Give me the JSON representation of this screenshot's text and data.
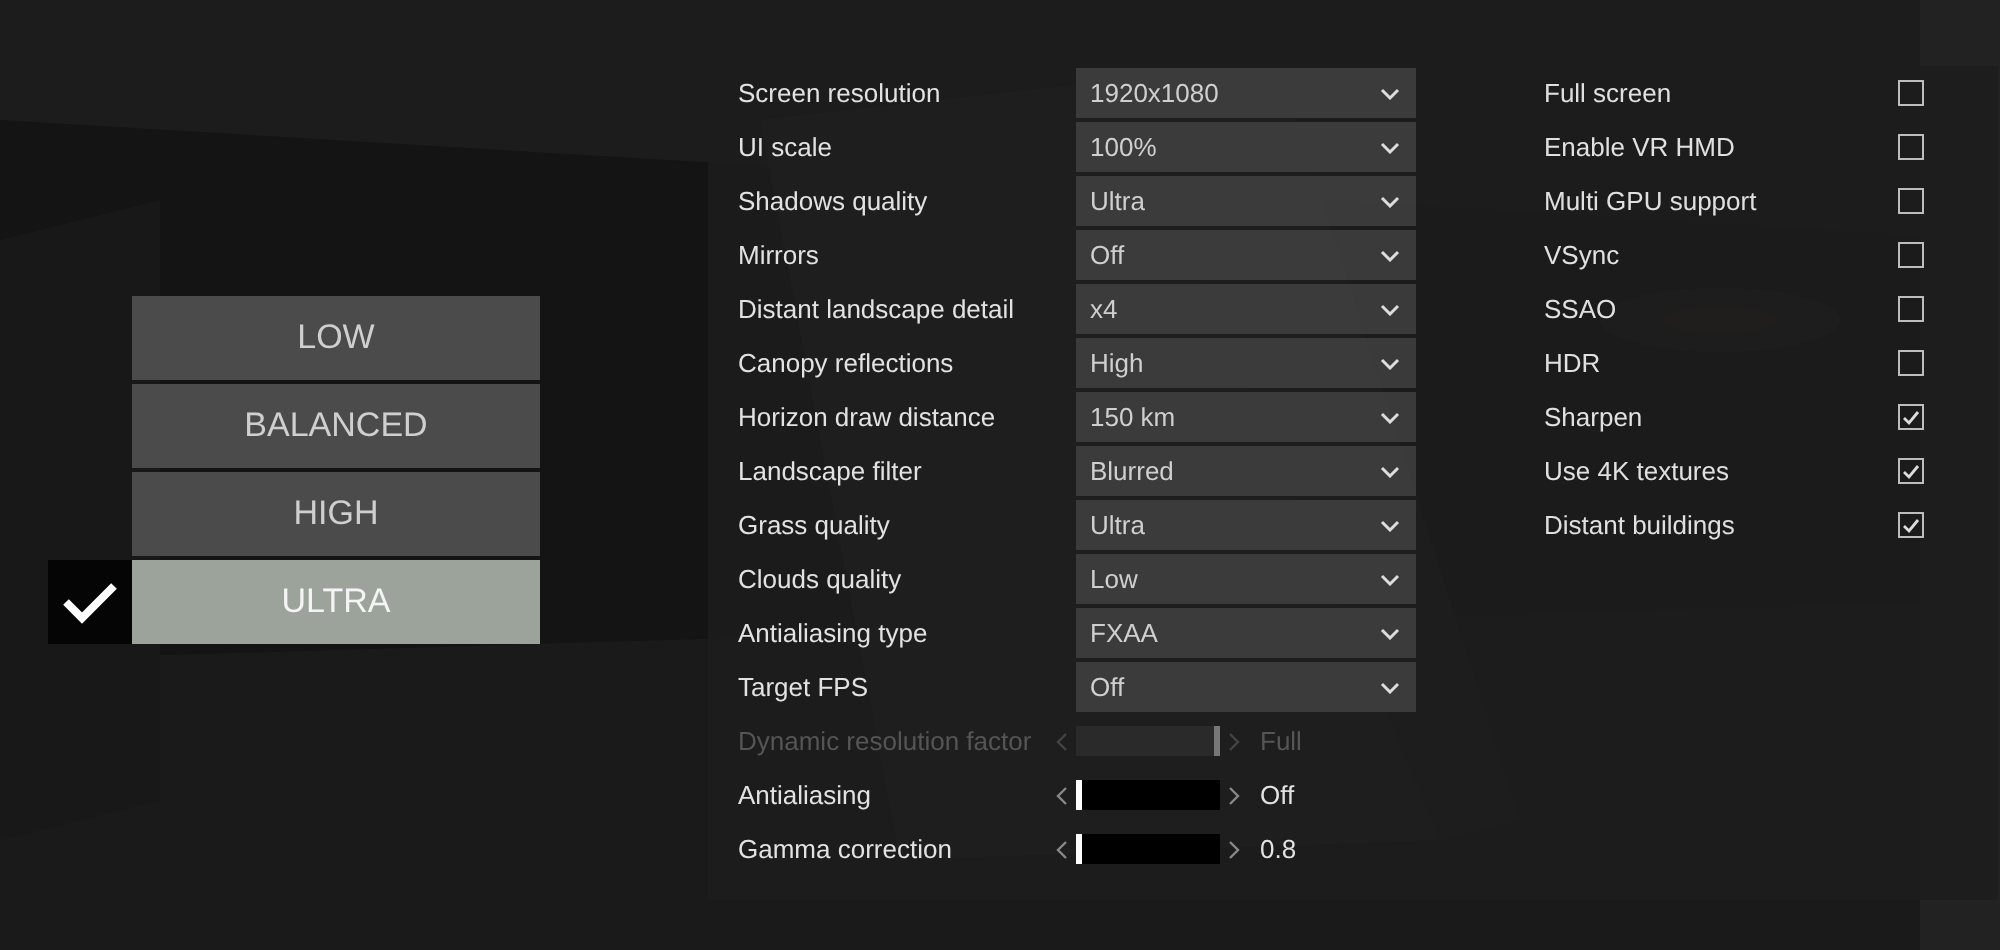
{
  "presets": [
    {
      "label": "LOW",
      "selected": false
    },
    {
      "label": "BALANCED",
      "selected": false
    },
    {
      "label": "HIGH",
      "selected": false
    },
    {
      "label": "ULTRA",
      "selected": true
    }
  ],
  "settings": [
    {
      "kind": "dropdown",
      "label": "Screen resolution",
      "value": "1920x1080"
    },
    {
      "kind": "dropdown",
      "label": "UI scale",
      "value": "100%"
    },
    {
      "kind": "dropdown",
      "label": "Shadows quality",
      "value": "Ultra"
    },
    {
      "kind": "dropdown",
      "label": "Mirrors",
      "value": "Off"
    },
    {
      "kind": "dropdown",
      "label": "Distant landscape detail",
      "value": "x4"
    },
    {
      "kind": "dropdown",
      "label": "Canopy reflections",
      "value": "High"
    },
    {
      "kind": "dropdown",
      "label": "Horizon draw distance",
      "value": "150 km"
    },
    {
      "kind": "dropdown",
      "label": "Landscape filter",
      "value": "Blurred"
    },
    {
      "kind": "dropdown",
      "label": "Grass quality",
      "value": "Ultra"
    },
    {
      "kind": "dropdown",
      "label": "Clouds quality",
      "value": "Low"
    },
    {
      "kind": "dropdown",
      "label": "Antialiasing type",
      "value": "FXAA"
    },
    {
      "kind": "dropdown",
      "label": "Target FPS",
      "value": "Off"
    },
    {
      "kind": "slider",
      "label": "Dynamic resolution factor",
      "level": 1,
      "reading": "Full",
      "disabled": true
    },
    {
      "kind": "slider",
      "label": "Antialiasing",
      "level": 0,
      "reading": "Off",
      "disabled": false
    },
    {
      "kind": "slider",
      "label": "Gamma correction",
      "level": 0,
      "reading": "0.8",
      "disabled": false
    }
  ],
  "toggles": [
    {
      "label": "Full screen",
      "checked": false
    },
    {
      "label": "Enable VR HMD",
      "checked": false
    },
    {
      "label": "Multi GPU support",
      "checked": false
    },
    {
      "label": "VSync",
      "checked": false
    },
    {
      "label": "SSAO",
      "checked": false
    },
    {
      "label": "HDR",
      "checked": false
    },
    {
      "label": "Sharpen",
      "checked": true
    },
    {
      "label": "Use 4K textures",
      "checked": true
    },
    {
      "label": "Distant buildings",
      "checked": true
    }
  ]
}
